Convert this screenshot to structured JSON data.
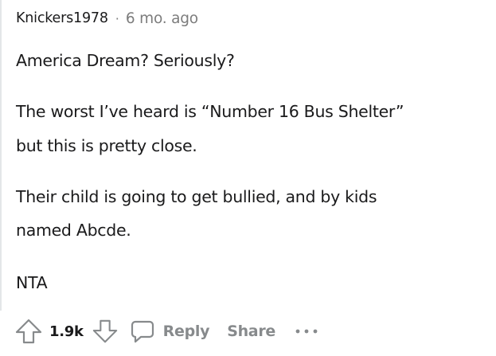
{
  "comment": {
    "author": "Knickers1978",
    "separator": "·",
    "age": "6 mo. ago",
    "paragraphs": [
      "America Dream? Seriously?",
      "The worst I’ve heard is “Number 16 Bus Shelter”",
      "but this is pretty close.",
      "Their child is going to get bullied, and by kids",
      "named Abcde.",
      "NTA"
    ]
  },
  "actions": {
    "upvote_count": "1.9k",
    "reply_label": "Reply",
    "share_label": "Share",
    "icons": [
      "upvote-icon",
      "downvote-icon",
      "comment-bubble-icon",
      "more-options-icon"
    ]
  },
  "colors": {
    "text": "#1a1a1b",
    "muted": "#7c7c7c",
    "action_gray": "#878a8c",
    "thread_line": "#e3e6e8"
  }
}
